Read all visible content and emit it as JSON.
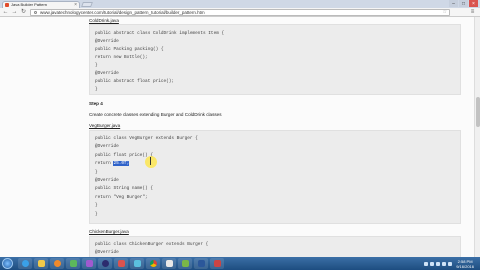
{
  "browser": {
    "tab_title": "Java Builder Pattern",
    "url": "www.javatechnologycenter.com/tutorial/design_pattern_tutorial/builder_pattern.htm"
  },
  "page": {
    "file1_name": "ColdDrink.java",
    "code1": [
      "public abstract class ColdDrink implements Item {",
      "@Override",
      "public Packing packing() {",
      "return new Bottle();",
      "}",
      "@Override",
      "public abstract float price();",
      "}"
    ],
    "step_label": "Step 4",
    "step_desc": "Create concrete classes extending Burger and ColdDrink classes",
    "file2_name": "VegBurger.java",
    "code2": [
      "public class VegBurger extends Burger {",
      "@Override",
      "public float price() {",
      "return ",
      "}",
      "@Override",
      "public String name() {",
      "return \"Veg Burger\";",
      "}",
      "}"
    ],
    "code2_selected": "25.0f;",
    "file3_name": "ChickenBurger.java",
    "code3": [
      "public class ChickenBurger extends Burger {",
      "@Override"
    ]
  },
  "taskbar": {
    "time": "2:58 PM",
    "date": "9/16/2016"
  }
}
